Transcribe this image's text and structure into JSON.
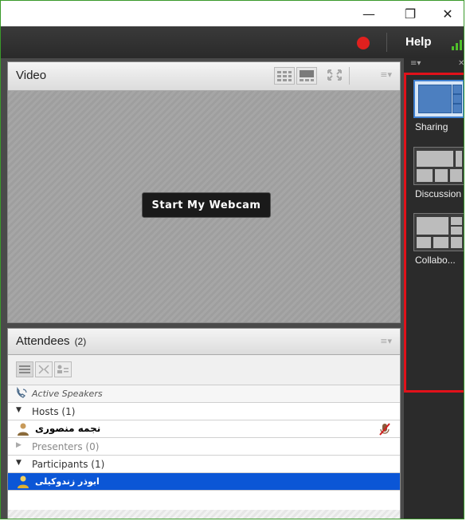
{
  "window": {
    "minimize_glyph": "—",
    "restore_glyph": "❐",
    "close_glyph": "✕"
  },
  "toolbar": {
    "help_label": "Help",
    "record_color": "#e0201e",
    "signal_color": "#4fc02a"
  },
  "video_pod": {
    "title": "Video",
    "start_webcam_label": "Start My Webcam",
    "menu_glyph": "≡▾"
  },
  "attendees_pod": {
    "title": "Attendees",
    "count": "(2)",
    "menu_glyph": "≡▾",
    "active_speakers": "Active Speakers",
    "hosts_label": "Hosts (1)",
    "host_name": "نجمه منصوری",
    "presenters_label": "Presenters (0)",
    "participants_label": "Participants (1)",
    "participant_name": "ابوذر زندوکیلی",
    "selected_row_color": "#0b56d6"
  },
  "layouts_panel": {
    "menu_glyph": "≡▾",
    "pin_glyph": "✕",
    "highlight_color": "#e1111a",
    "items": [
      {
        "label": "Sharing",
        "selected": true
      },
      {
        "label": "Discussion",
        "selected": false
      },
      {
        "label": "Collabo...",
        "selected": false
      }
    ]
  }
}
